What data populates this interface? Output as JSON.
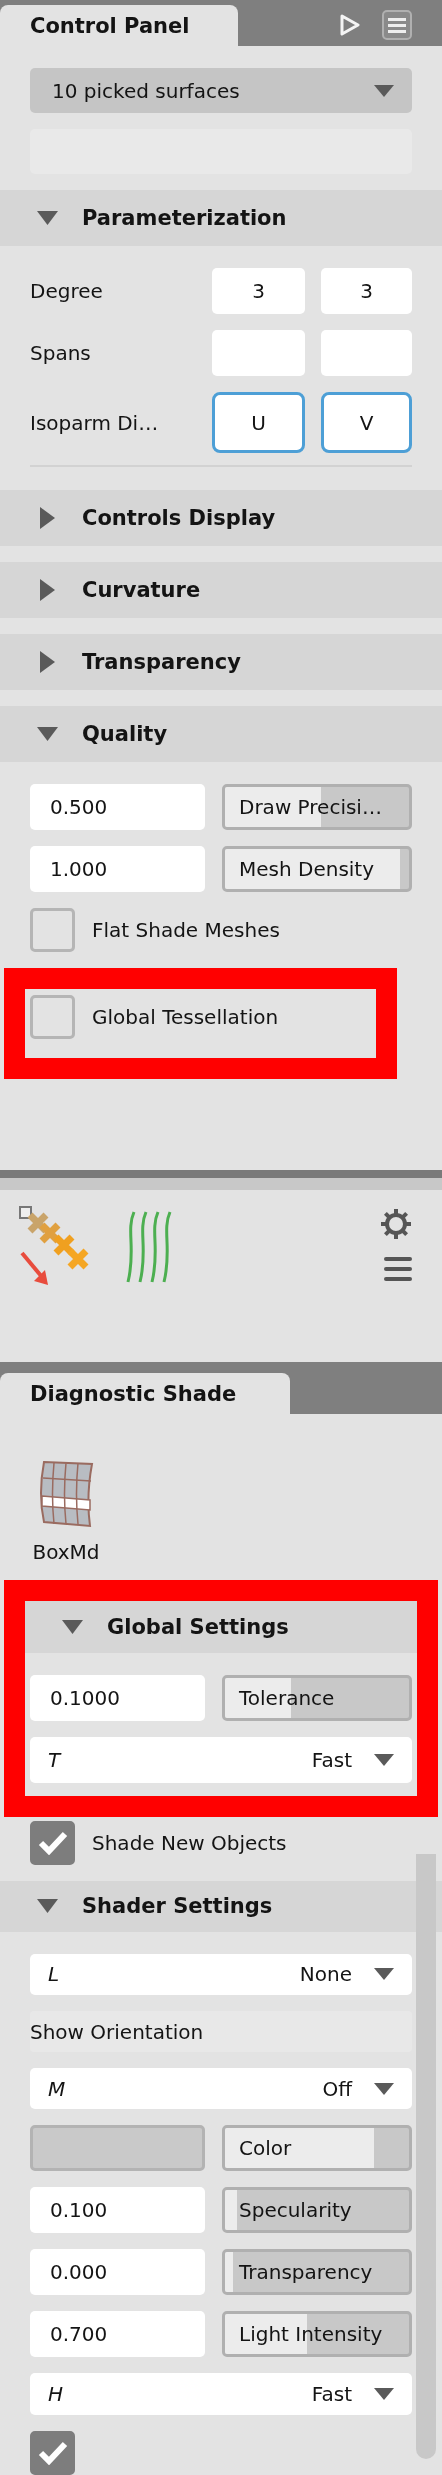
{
  "control_panel": {
    "tab": "Control Panel",
    "items": [
      {
        "kind": "select",
        "value": "10 picked surfaces"
      },
      {
        "kind": "blank_field"
      },
      {
        "kind": "header",
        "title": "Parameterization",
        "expanded": true
      },
      {
        "kind": "pair",
        "label": "Degree",
        "values": [
          "3",
          "3"
        ]
      },
      {
        "kind": "pair",
        "label": "Spans"
      },
      {
        "kind": "toggle_pair",
        "label": "Isoparm Di…",
        "buttons": [
          {
            "label": "U",
            "selected": true
          },
          {
            "label": "V",
            "selected": true
          }
        ]
      },
      {
        "kind": "divider"
      },
      {
        "kind": "header",
        "title": "Controls Display",
        "expanded": false
      },
      {
        "kind": "header",
        "title": "Curvature",
        "expanded": false
      },
      {
        "kind": "header",
        "title": "Transparency",
        "expanded": false
      },
      {
        "kind": "header",
        "title": "Quality",
        "expanded": true
      },
      {
        "kind": "slider",
        "value": "0.500",
        "label": "Draw Precisi…",
        "level": 0.5
      },
      {
        "kind": "slider",
        "value": "1.000",
        "label": "Mesh Density",
        "level": 0.95
      },
      {
        "kind": "checkbox",
        "label": "Flat Shade Meshes",
        "checked": false
      },
      {
        "kind": "highlight",
        "children": [
          {
            "kind": "checkbox",
            "label": "Global Tessellation",
            "checked": false
          }
        ]
      }
    ]
  },
  "diagnostic_shade": {
    "tab": "Diagnostic Shade",
    "object": {
      "label": "BoxMd"
    },
    "items": [
      {
        "kind": "highlight",
        "children": [
          {
            "kind": "header",
            "title": "Global Settings",
            "expanded": true
          },
          {
            "kind": "slider",
            "value": "0.1000",
            "label": "Tolerance",
            "level": 0.33
          },
          {
            "kind": "dropdown",
            "letter": "T",
            "value": "Fast"
          }
        ]
      },
      {
        "kind": "checkbox",
        "label": "Shade New Objects",
        "checked": true
      },
      {
        "kind": "header",
        "title": "Shader Settings",
        "expanded": true
      },
      {
        "kind": "dropdown",
        "letter": "L",
        "value": "None"
      },
      {
        "kind": "label_row",
        "label": "Show Orientation"
      },
      {
        "kind": "dropdown",
        "letter": "M",
        "value": "Off"
      },
      {
        "kind": "swatch_slider",
        "label": "Color",
        "level": 0.8
      },
      {
        "kind": "slider",
        "value": "0.100",
        "label": "Specularity",
        "level": 0.02
      },
      {
        "kind": "slider",
        "value": "0.000",
        "label": "Transparency",
        "level": 0.0
      },
      {
        "kind": "slider",
        "value": "0.700",
        "label": "Light Intensity",
        "level": 0.42
      },
      {
        "kind": "dropdown",
        "letter": "H",
        "value": "Fast"
      },
      {
        "kind": "checkbox",
        "checked": true
      }
    ]
  }
}
